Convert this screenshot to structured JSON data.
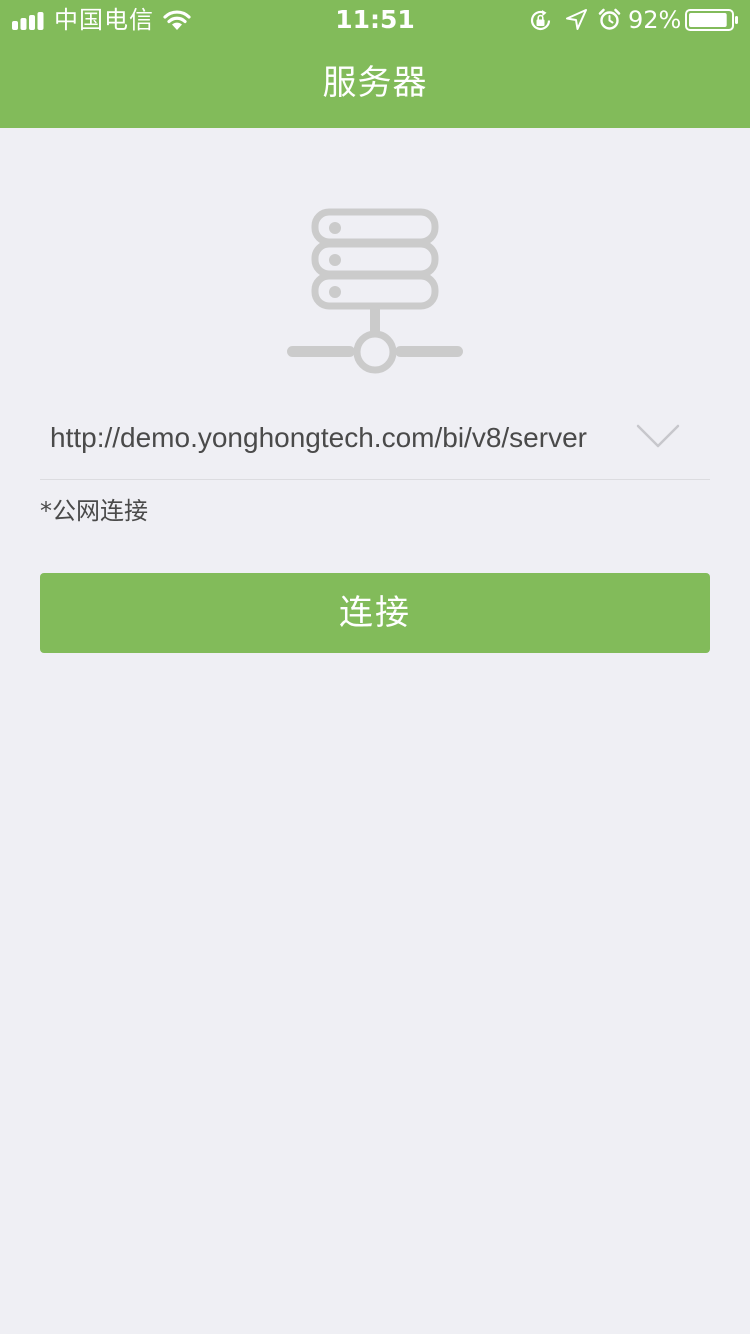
{
  "status_bar": {
    "carrier": "中国电信",
    "time": "11:51",
    "battery_percent": "92%",
    "battery_level": 0.92,
    "signal_bars": 4,
    "icons": [
      "signal-icon",
      "wifi-icon",
      "rotation-lock-icon",
      "location-arrow-icon",
      "alarm-clock-icon",
      "battery-icon"
    ]
  },
  "nav": {
    "title": "服务器"
  },
  "main": {
    "illustration_icon": "server-network-icon",
    "server_url": {
      "value": "http://demo.yonghongtech.com/bi/v8/server",
      "dropdown_icon": "chevron-down-icon"
    },
    "connection_type": "*公网连接",
    "connect_label": "连接"
  },
  "colors": {
    "accent": "#82bb5a",
    "background": "#efeff4",
    "illustration_gray": "#cbcbcb",
    "text": "#4a4a4a",
    "divider": "#dcdce0"
  }
}
